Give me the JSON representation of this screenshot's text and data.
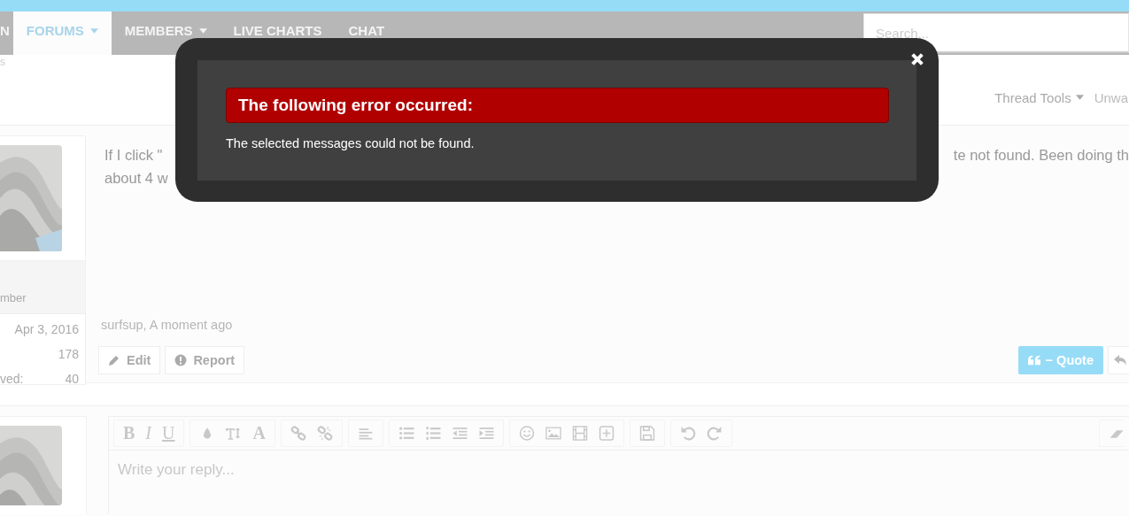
{
  "nav": {
    "tabs": [
      {
        "label": "N",
        "selected": false,
        "has_menu": false
      },
      {
        "label": "FORUMS",
        "selected": true,
        "has_menu": true
      },
      {
        "label": "MEMBERS",
        "selected": false,
        "has_menu": true
      },
      {
        "label": "LIVE CHARTS",
        "selected": false,
        "has_menu": false
      },
      {
        "label": "CHAT",
        "selected": false,
        "has_menu": false
      }
    ],
    "search": {
      "placeholder": "Search..."
    }
  },
  "breadcrumb_fragment": "s",
  "thread_actions": [
    {
      "label": "Thread Tools",
      "has_menu": true
    },
    {
      "label": "Unwa",
      "has_menu": false
    }
  ],
  "post": {
    "user": {
      "role_fragment": "mber",
      "stats": [
        {
          "value": "Apr 3, 2016"
        },
        {
          "value": "178"
        },
        {
          "label": "ved:",
          "value": "40"
        }
      ]
    },
    "text_lines": [
      {
        "before": "If I click \"",
        "after": "te not found. Been doing th"
      },
      {
        "before": "about 4 w"
      }
    ],
    "meta": "surfsup, A moment ago",
    "left_buttons": [
      {
        "kind": "edit",
        "label": "Edit"
      },
      {
        "kind": "report",
        "label": "Report"
      }
    ],
    "quote_button": {
      "label": "− Quote"
    }
  },
  "reply": {
    "toolbar_letters": [
      "B",
      "I",
      "U"
    ],
    "font_letter": "A",
    "placeholder": "Write your reply..."
  },
  "dialog": {
    "title": "The following error occurred:",
    "message": "The selected messages could not be found."
  }
}
